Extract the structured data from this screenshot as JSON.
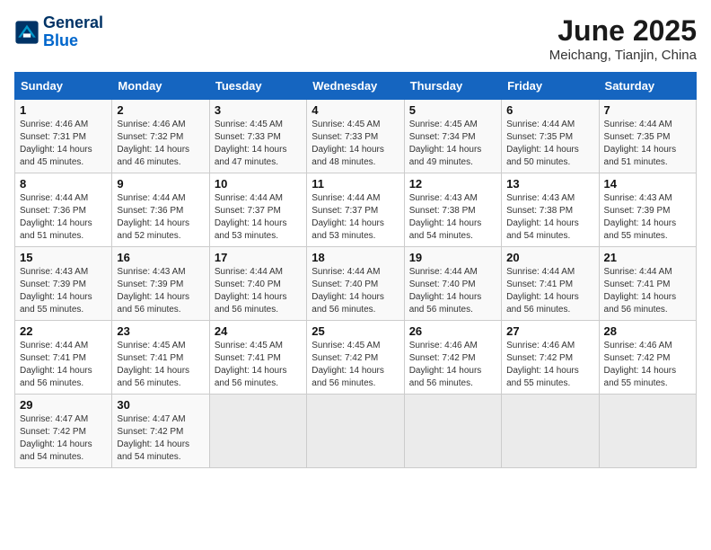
{
  "logo": {
    "line1": "General",
    "line2": "Blue"
  },
  "title": "June 2025",
  "subtitle": "Meichang, Tianjin, China",
  "days_of_week": [
    "Sunday",
    "Monday",
    "Tuesday",
    "Wednesday",
    "Thursday",
    "Friday",
    "Saturday"
  ],
  "weeks": [
    [
      {
        "day": "1",
        "info": "Sunrise: 4:46 AM\nSunset: 7:31 PM\nDaylight: 14 hours\nand 45 minutes."
      },
      {
        "day": "2",
        "info": "Sunrise: 4:46 AM\nSunset: 7:32 PM\nDaylight: 14 hours\nand 46 minutes."
      },
      {
        "day": "3",
        "info": "Sunrise: 4:45 AM\nSunset: 7:33 PM\nDaylight: 14 hours\nand 47 minutes."
      },
      {
        "day": "4",
        "info": "Sunrise: 4:45 AM\nSunset: 7:33 PM\nDaylight: 14 hours\nand 48 minutes."
      },
      {
        "day": "5",
        "info": "Sunrise: 4:45 AM\nSunset: 7:34 PM\nDaylight: 14 hours\nand 49 minutes."
      },
      {
        "day": "6",
        "info": "Sunrise: 4:44 AM\nSunset: 7:35 PM\nDaylight: 14 hours\nand 50 minutes."
      },
      {
        "day": "7",
        "info": "Sunrise: 4:44 AM\nSunset: 7:35 PM\nDaylight: 14 hours\nand 51 minutes."
      }
    ],
    [
      {
        "day": "8",
        "info": "Sunrise: 4:44 AM\nSunset: 7:36 PM\nDaylight: 14 hours\nand 51 minutes."
      },
      {
        "day": "9",
        "info": "Sunrise: 4:44 AM\nSunset: 7:36 PM\nDaylight: 14 hours\nand 52 minutes."
      },
      {
        "day": "10",
        "info": "Sunrise: 4:44 AM\nSunset: 7:37 PM\nDaylight: 14 hours\nand 53 minutes."
      },
      {
        "day": "11",
        "info": "Sunrise: 4:44 AM\nSunset: 7:37 PM\nDaylight: 14 hours\nand 53 minutes."
      },
      {
        "day": "12",
        "info": "Sunrise: 4:43 AM\nSunset: 7:38 PM\nDaylight: 14 hours\nand 54 minutes."
      },
      {
        "day": "13",
        "info": "Sunrise: 4:43 AM\nSunset: 7:38 PM\nDaylight: 14 hours\nand 54 minutes."
      },
      {
        "day": "14",
        "info": "Sunrise: 4:43 AM\nSunset: 7:39 PM\nDaylight: 14 hours\nand 55 minutes."
      }
    ],
    [
      {
        "day": "15",
        "info": "Sunrise: 4:43 AM\nSunset: 7:39 PM\nDaylight: 14 hours\nand 55 minutes."
      },
      {
        "day": "16",
        "info": "Sunrise: 4:43 AM\nSunset: 7:39 PM\nDaylight: 14 hours\nand 56 minutes."
      },
      {
        "day": "17",
        "info": "Sunrise: 4:44 AM\nSunset: 7:40 PM\nDaylight: 14 hours\nand 56 minutes."
      },
      {
        "day": "18",
        "info": "Sunrise: 4:44 AM\nSunset: 7:40 PM\nDaylight: 14 hours\nand 56 minutes."
      },
      {
        "day": "19",
        "info": "Sunrise: 4:44 AM\nSunset: 7:40 PM\nDaylight: 14 hours\nand 56 minutes."
      },
      {
        "day": "20",
        "info": "Sunrise: 4:44 AM\nSunset: 7:41 PM\nDaylight: 14 hours\nand 56 minutes."
      },
      {
        "day": "21",
        "info": "Sunrise: 4:44 AM\nSunset: 7:41 PM\nDaylight: 14 hours\nand 56 minutes."
      }
    ],
    [
      {
        "day": "22",
        "info": "Sunrise: 4:44 AM\nSunset: 7:41 PM\nDaylight: 14 hours\nand 56 minutes."
      },
      {
        "day": "23",
        "info": "Sunrise: 4:45 AM\nSunset: 7:41 PM\nDaylight: 14 hours\nand 56 minutes."
      },
      {
        "day": "24",
        "info": "Sunrise: 4:45 AM\nSunset: 7:41 PM\nDaylight: 14 hours\nand 56 minutes."
      },
      {
        "day": "25",
        "info": "Sunrise: 4:45 AM\nSunset: 7:42 PM\nDaylight: 14 hours\nand 56 minutes."
      },
      {
        "day": "26",
        "info": "Sunrise: 4:46 AM\nSunset: 7:42 PM\nDaylight: 14 hours\nand 56 minutes."
      },
      {
        "day": "27",
        "info": "Sunrise: 4:46 AM\nSunset: 7:42 PM\nDaylight: 14 hours\nand 55 minutes."
      },
      {
        "day": "28",
        "info": "Sunrise: 4:46 AM\nSunset: 7:42 PM\nDaylight: 14 hours\nand 55 minutes."
      }
    ],
    [
      {
        "day": "29",
        "info": "Sunrise: 4:47 AM\nSunset: 7:42 PM\nDaylight: 14 hours\nand 54 minutes."
      },
      {
        "day": "30",
        "info": "Sunrise: 4:47 AM\nSunset: 7:42 PM\nDaylight: 14 hours\nand 54 minutes."
      },
      {
        "day": "",
        "info": ""
      },
      {
        "day": "",
        "info": ""
      },
      {
        "day": "",
        "info": ""
      },
      {
        "day": "",
        "info": ""
      },
      {
        "day": "",
        "info": ""
      }
    ]
  ]
}
